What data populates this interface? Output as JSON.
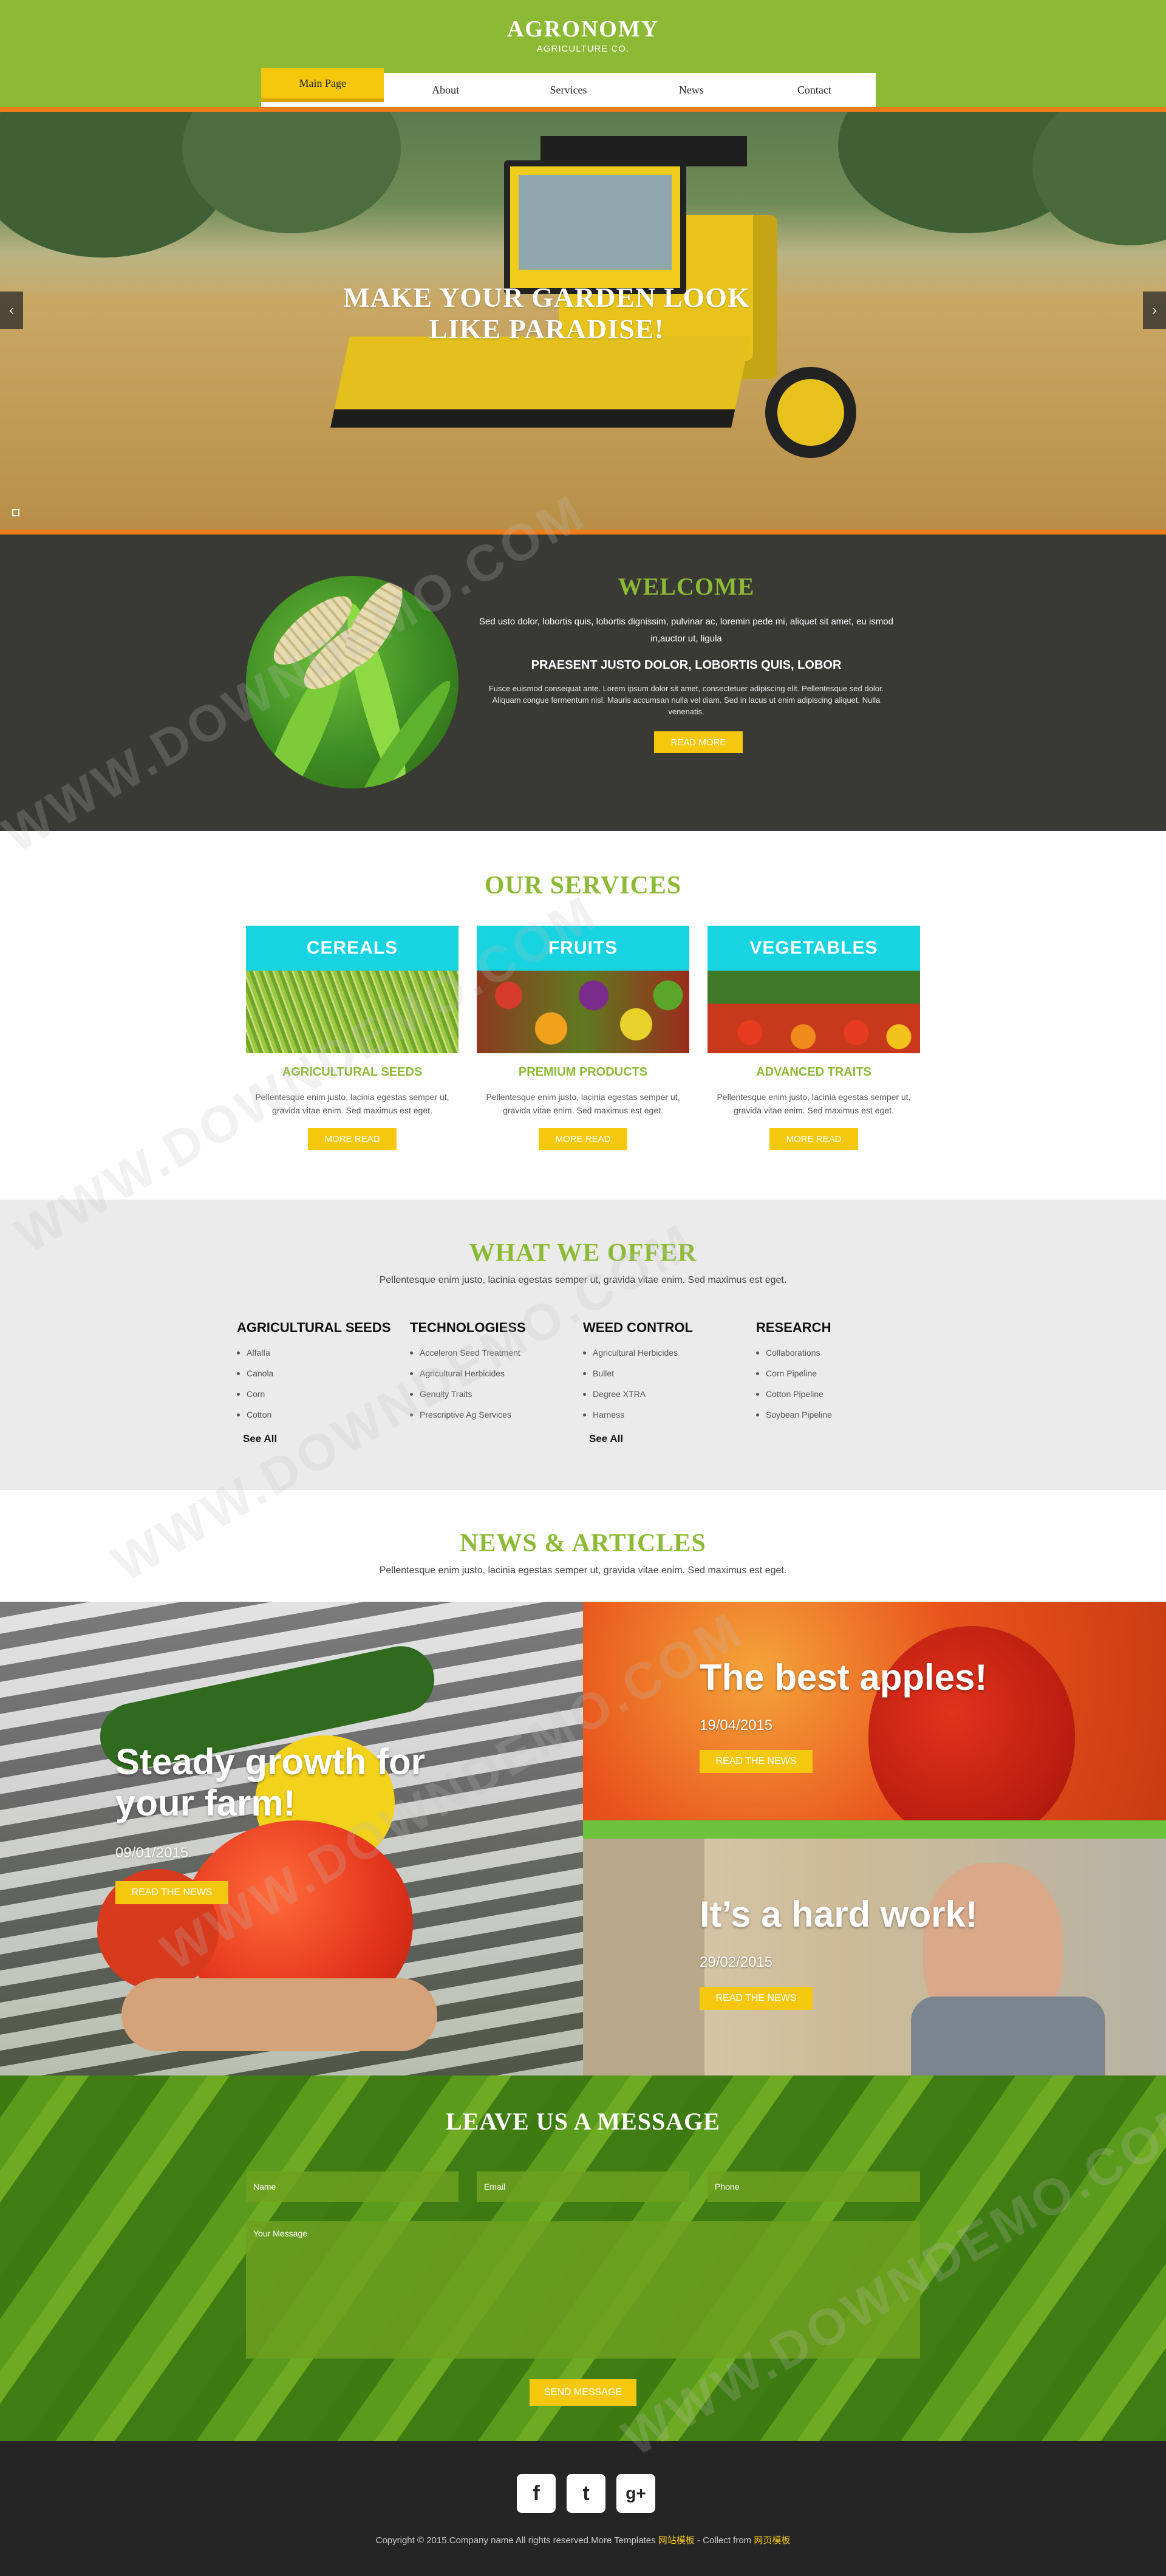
{
  "header": {
    "logo": "AGRONOMY",
    "tagline": "AGRICULTURE CO.",
    "nav": [
      "Main Page",
      "About",
      "Services",
      "News",
      "Contact"
    ],
    "active_nav": "Main Page"
  },
  "hero": {
    "title": "MAKE YOUR GARDEN LOOK LIKE PARADISE!",
    "arrow_left": "‹",
    "arrow_right": "›"
  },
  "welcome": {
    "title": "WELCOME",
    "p1": "Sed usto dolor, lobortis quis, lobortis dignissim, pulvinar ac, loremin pede mi, aliquet sit amet, eu ismod in,auctor ut, ligula",
    "subtitle": "PRAESENT JUSTO DOLOR, LOBORTIS QUIS, LOBOR",
    "p2": "Fusce euismod consequat ante. Lorem ipsum dolor sit amet, consectetuer adipiscing elit. Pellentesque sed dolor. Aliquam congue fermentum nisl. Mauris accumsan nulla vel diam. Sed in lacus ut enim adipiscing aliquet. Nulla venenatis.",
    "button": "READ MORE"
  },
  "services": {
    "title": "OUR SERVICES",
    "items": [
      {
        "head": "CEREALS",
        "sub": "AGRICULTURAL SEEDS",
        "text": "Pellentesque enim justo, lacinia egestas semper ut, gravida vitae enim. Sed maximus est eget.",
        "button": "MORE READ"
      },
      {
        "head": "FRUITS",
        "sub": "PREMIUM PRODUCTS",
        "text": "Pellentesque enim justo, lacinia egestas semper ut, gravida vitae enim. Sed maximus est eget.",
        "button": "MORE READ"
      },
      {
        "head": "VEGETABLES",
        "sub": "ADVANCED TRAITS",
        "text": "Pellentesque enim justo, lacinia egestas semper ut, gravida vitae enim. Sed maximus est eget.",
        "button": "MORE READ"
      }
    ]
  },
  "offer": {
    "title": "WHAT WE OFFER",
    "desc": "Pellentesque enim justo, lacinia egestas semper ut, gravida vitae enim. Sed maximus est eget.",
    "columns": [
      {
        "head": "AGRICULTURAL SEEDS",
        "items": [
          "Alfalfa",
          "Canola",
          "Corn",
          "Cotton"
        ],
        "see_all": "See All"
      },
      {
        "head": "TECHNOLOGIESS",
        "items": [
          "Acceleron Seed Treatment",
          "Agricultural Herbicides",
          "Genuity Traits",
          "Prescriptive Ag Services"
        ],
        "see_all": ""
      },
      {
        "head": "WEED CONTROL",
        "items": [
          "Agricultural Herbicides",
          "Bullet",
          "Degree XTRA",
          "Harness"
        ],
        "see_all": "See All"
      },
      {
        "head": "RESEARCH",
        "items": [
          "Collaborations",
          "Corn Pipeline",
          "Cotton Pipeline",
          "Soybean Pipeline"
        ],
        "see_all": ""
      }
    ]
  },
  "news": {
    "title": "NEWS & ARTICLES",
    "desc": "Pellentesque enim justo, lacinia egestas semper ut, gravida vitae enim. Sed maximus est eget.",
    "cards": [
      {
        "title": "Steady growth for your farm!",
        "date": "09/01/2015",
        "button": "READ THE NEWS"
      },
      {
        "title": "The best apples!",
        "date": "19/04/2015",
        "button": "READ THE NEWS"
      },
      {
        "title": "It’s a hard work!",
        "date": "29/02/2015",
        "button": "READ THE NEWS"
      }
    ]
  },
  "contact": {
    "title": "LEAVE US A MESSAGE",
    "name_placeholder": "Name",
    "email_placeholder": "Email",
    "phone_placeholder": "Phone",
    "message_placeholder": "Your Message",
    "button": "SEND MESSAGE"
  },
  "footer": {
    "social": [
      "f",
      "t",
      "g+"
    ],
    "copyright": "Copyright © 2015.Company name All rights reserved.More Templates",
    "link1": "网站模板",
    "collect": "- Collect from",
    "link2": "网页模板"
  },
  "watermark": "WWW.DOWNDEMO.COM",
  "colors": {
    "green": "#8dba35",
    "orange": "#f07c1a",
    "yellow": "#f5c80d",
    "cyan": "#17d4e0",
    "dark": "#3a3a35",
    "footer": "#252525"
  }
}
